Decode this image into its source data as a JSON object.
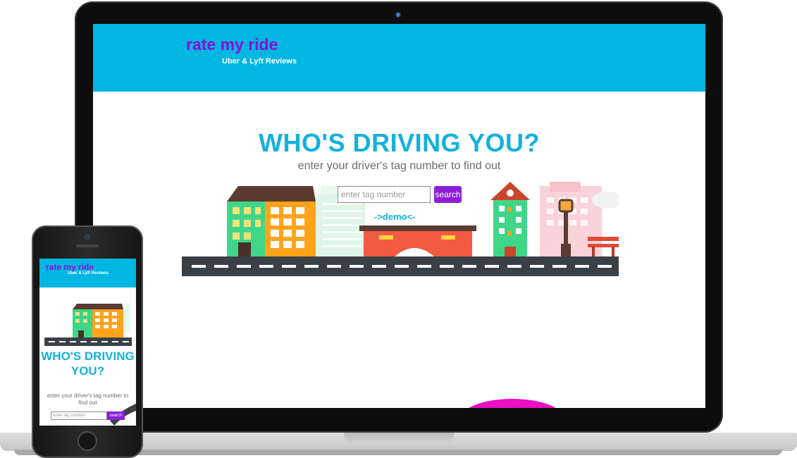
{
  "desktop": {
    "brand": "rate my ride",
    "tagline": "Uber & Lyft Reviews",
    "hero_title": "WHO'S DRIVING YOU?",
    "hero_subtitle": "enter your driver's tag number to find out",
    "search_placeholder": "enter tag number",
    "search_button": "search",
    "demo_link": "->demo<-"
  },
  "mobile": {
    "brand": "rate my ride",
    "tagline": "Uber & Lyft Reviews",
    "hero_title": "WHO'S DRIVING YOU?",
    "hero_subtitle": "enter your driver's tag number to find out",
    "search_placeholder": "enter tag number",
    "search_button": "search"
  },
  "colors": {
    "header": "#00b6e3",
    "brand": "#8b0fd6",
    "accent_title": "#14b1dd",
    "button": "#8e1dd9",
    "blob": "#e812c4"
  }
}
